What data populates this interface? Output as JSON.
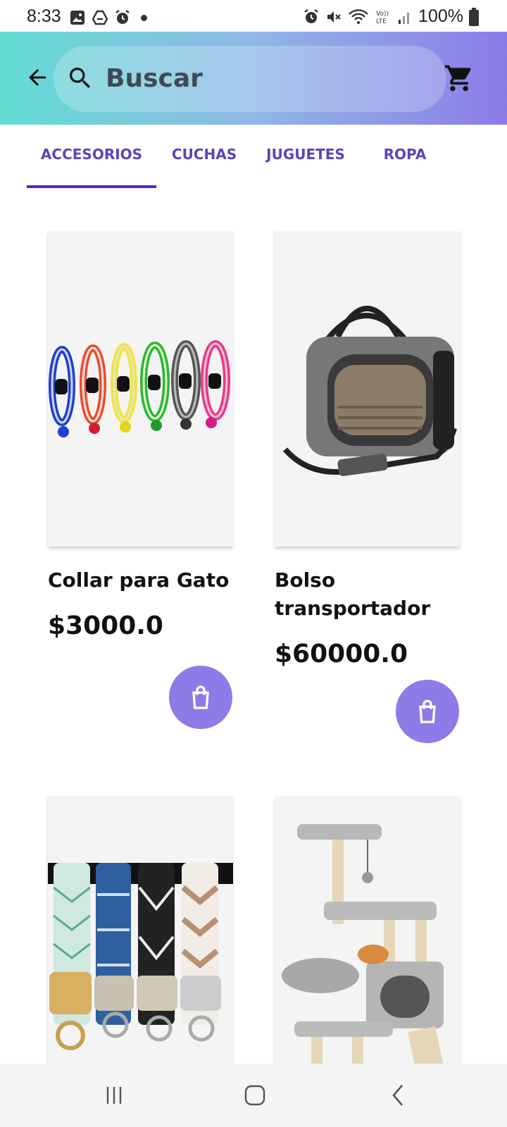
{
  "status_bar": {
    "time": "8:33",
    "battery": "100%",
    "icons": [
      "gallery-icon",
      "drive-icon",
      "alarm-icon",
      "alarm-icon",
      "mute-icon",
      "wifi-icon",
      "volte-icon",
      "signal-icon",
      "battery-icon"
    ]
  },
  "header": {
    "search_placeholder": "Buscar",
    "gradient_colors": [
      "#63ddd3",
      "#8c7ce8"
    ]
  },
  "tabs": [
    {
      "label": "ACCESORIOS",
      "selected": true
    },
    {
      "label": "CUCHAS",
      "selected": false
    },
    {
      "label": "JUGUETES",
      "selected": false
    },
    {
      "label": "ROPA",
      "selected": false
    }
  ],
  "products": [
    {
      "title": "Collar para Gato",
      "price": "$3000.0"
    },
    {
      "title": "Bolso transportador",
      "price": "$60000.0"
    },
    {
      "title": "",
      "price": ""
    },
    {
      "title": "",
      "price": ""
    }
  ],
  "colors": {
    "accent": "#5a24c8",
    "tab_text": "#5b45b8",
    "bag_button": "#8d7be7"
  }
}
